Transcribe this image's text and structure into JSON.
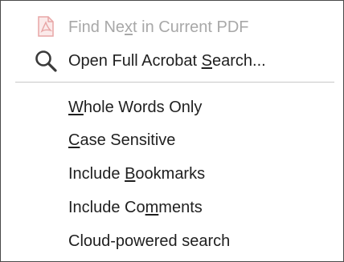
{
  "menu": {
    "items": [
      {
        "pre": "Find Ne",
        "key": "x",
        "post": "t in Current PDF",
        "icon": "pdf-file-icon",
        "enabled": false
      },
      {
        "pre": "Open Full Acrobat ",
        "key": "S",
        "post": "earch...",
        "icon": "search-icon",
        "enabled": true
      },
      {
        "pre": "",
        "key": "W",
        "post": "hole Words Only",
        "enabled": true
      },
      {
        "pre": "",
        "key": "C",
        "post": "ase Sensitive",
        "enabled": true
      },
      {
        "pre": "Include ",
        "key": "B",
        "post": "ookmarks",
        "enabled": true
      },
      {
        "pre": "Include Co",
        "key": "m",
        "post": "ments",
        "enabled": true
      },
      {
        "pre": "Cloud-powered search",
        "key": "",
        "post": "",
        "enabled": true
      }
    ]
  },
  "colors": {
    "text": "#1f1f1f",
    "disabled_text": "#a8a8a8",
    "pdf_icon": "#e8a6a6"
  }
}
